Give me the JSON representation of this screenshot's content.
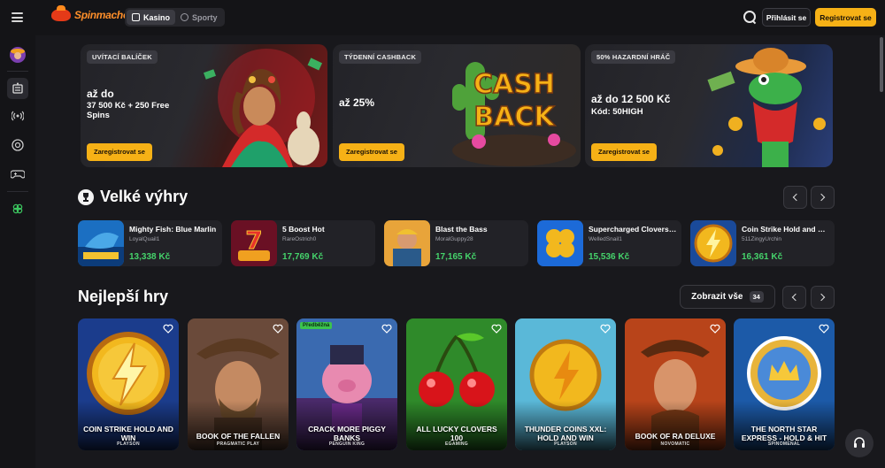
{
  "header": {
    "logo_text": "Spinmacho",
    "modes": [
      {
        "label": "Kasino",
        "active": true
      },
      {
        "label": "Sporty",
        "active": false
      }
    ],
    "login_label": "Přihlásit se",
    "register_label": "Registrovat se"
  },
  "sidebar": {
    "items": [
      {
        "icon": "avatar-icon"
      },
      {
        "icon": "slot-machine-icon",
        "active": true
      },
      {
        "icon": "live-broadcast-icon"
      },
      {
        "icon": "roulette-icon"
      },
      {
        "icon": "gamepad-icon"
      },
      {
        "icon": "clover-icon"
      }
    ]
  },
  "promos": [
    {
      "badge": "UVÍTACÍ BALÍČEK",
      "title": "až do",
      "subtitle": "37 500 Kč + 250 Free Spins",
      "button": "Zaregistrovat se"
    },
    {
      "badge": "TÝDENNÍ CASHBACK",
      "title": "až 25%",
      "subtitle": "",
      "art_text_1": "CASH",
      "art_text_2": "BACK",
      "button": "Zaregistrovat se"
    },
    {
      "badge": "50% HAZARDNÍ HRÁČ",
      "title": "až do 12 500 Kč",
      "subtitle": "Kód: 50HIGH",
      "button": "Zaregistrovat se"
    }
  ],
  "big_wins": {
    "title": "Velké výhry",
    "items": [
      {
        "game": "Mighty Fish: Blue Marlin",
        "user": "LoyalQuail1",
        "amount": "13,338 Kč"
      },
      {
        "game": "5 Boost Hot",
        "user": "RareOstrich0",
        "amount": "17,769 Kč"
      },
      {
        "game": "Blast the Bass",
        "user": "MoralGuppy28",
        "amount": "17,165 Kč"
      },
      {
        "game": "Supercharged Clovers: Hold and Win",
        "user": "WelledSnail1",
        "amount": "15,536 Kč"
      },
      {
        "game": "Coin Strike Hold and Win",
        "user": "511ZingyUrchin",
        "amount": "16,361 Kč"
      }
    ]
  },
  "top_games": {
    "title": "Nejlepší hry",
    "show_all_label": "Zobrazit vše",
    "count": "34",
    "items": [
      {
        "name": "COIN STRIKE HOLD AND WIN",
        "provider": "PLAYSON",
        "tag": ""
      },
      {
        "name": "BOOK OF THE FALLEN",
        "provider": "PRAGMATIC PLAY",
        "tag": ""
      },
      {
        "name": "CRACK MORE PIGGY BANKS",
        "provider": "PENGUIN KING",
        "tag": "Předběžná"
      },
      {
        "name": "ALL LUCKY CLOVERS 100",
        "provider": "EGAMING",
        "tag": ""
      },
      {
        "name": "THUNDER COINS XXL: HOLD AND WIN",
        "provider": "PLAYSON",
        "tag": ""
      },
      {
        "name": "BOOK OF RA DELUXE",
        "provider": "NOVOMATIC",
        "tag": ""
      },
      {
        "name": "THE NORTH STAR EXPRESS - HOLD & HIT",
        "provider": "SPINOMENAL",
        "tag": ""
      }
    ]
  },
  "colors": {
    "accent": "#f6b116",
    "win_green": "#45d36b",
    "background": "#18181c"
  }
}
